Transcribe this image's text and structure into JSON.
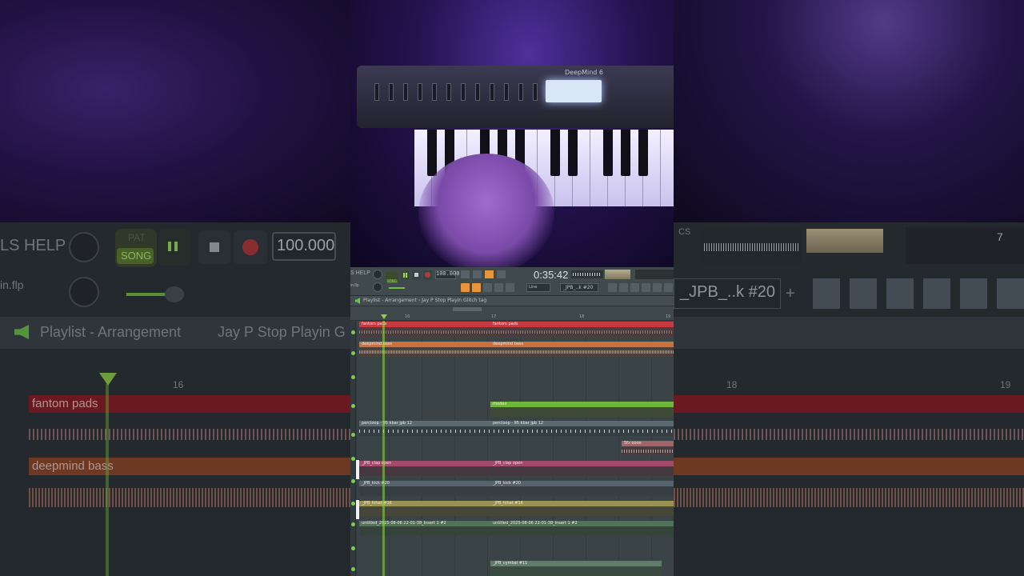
{
  "bg_left": {
    "menu": "LS HELP",
    "song_label": "SONG",
    "pat_label": "PAT",
    "tempo": "100.000",
    "file": "in.flp",
    "playlist_title": "Playlist - Arrangement",
    "breadcrumb": "Jay P Stop Playin G",
    "bar_16": "16",
    "track_fantom": "fantom pads",
    "track_deepmind": "deepmind bass"
  },
  "bg_right": {
    "pattern": "_JPB_..k #20",
    "plus": "+",
    "bar_18": "18",
    "bar_19": "19",
    "counter": "7",
    "cs": "CS"
  },
  "synth": {
    "brand": "DeepMind 6"
  },
  "fl": {
    "menu": "S HELP",
    "song_label": "SONG",
    "tempo": "100.000",
    "time": "0:35:42",
    "file": "in.flp",
    "pattern_selector": "_JPB_..k #20",
    "snap": "Line",
    "playlist_title": "Playlist - Arrangement",
    "breadcrumb": "Jay P Stop Playin Glitch tag",
    "ruler": [
      "16",
      "17",
      "18",
      "19"
    ],
    "clips": [
      {
        "label": "fantom pads",
        "label2": "fantom pads",
        "color": "#c8383f"
      },
      {
        "label": "deepmind bass",
        "label2": "deepmind bass",
        "color": "#c9703d"
      },
      {
        "label": "rhodes",
        "color": "#6fb53a"
      },
      {
        "label": "percloop - 95 kbar jpb 12",
        "label2": "percloop - 95 kbar jpb 12",
        "color": "#5a6a70"
      },
      {
        "label": "5fx oooo",
        "color": "#a0646a"
      },
      {
        "label": "_JPB_clap open",
        "label2": "_JPB_clap open",
        "color": "#a24a6a"
      },
      {
        "label": "_JPB_kick #20",
        "label2": "_JPB_kick #20",
        "color": "#56626e"
      },
      {
        "label": "_JPB_hihat #16",
        "label2": "_JPB_hihat #16",
        "color": "#9a9252"
      },
      {
        "label": "untitled_2025-08-06 22-01-38_Insert 1 #2",
        "label2": "untitled_2025-08-06 22-01-38_Insert 1 #2",
        "color": "#4f7358"
      },
      {
        "label": "_JPB_cymbal #11",
        "color": "#5f7e6a"
      }
    ]
  }
}
